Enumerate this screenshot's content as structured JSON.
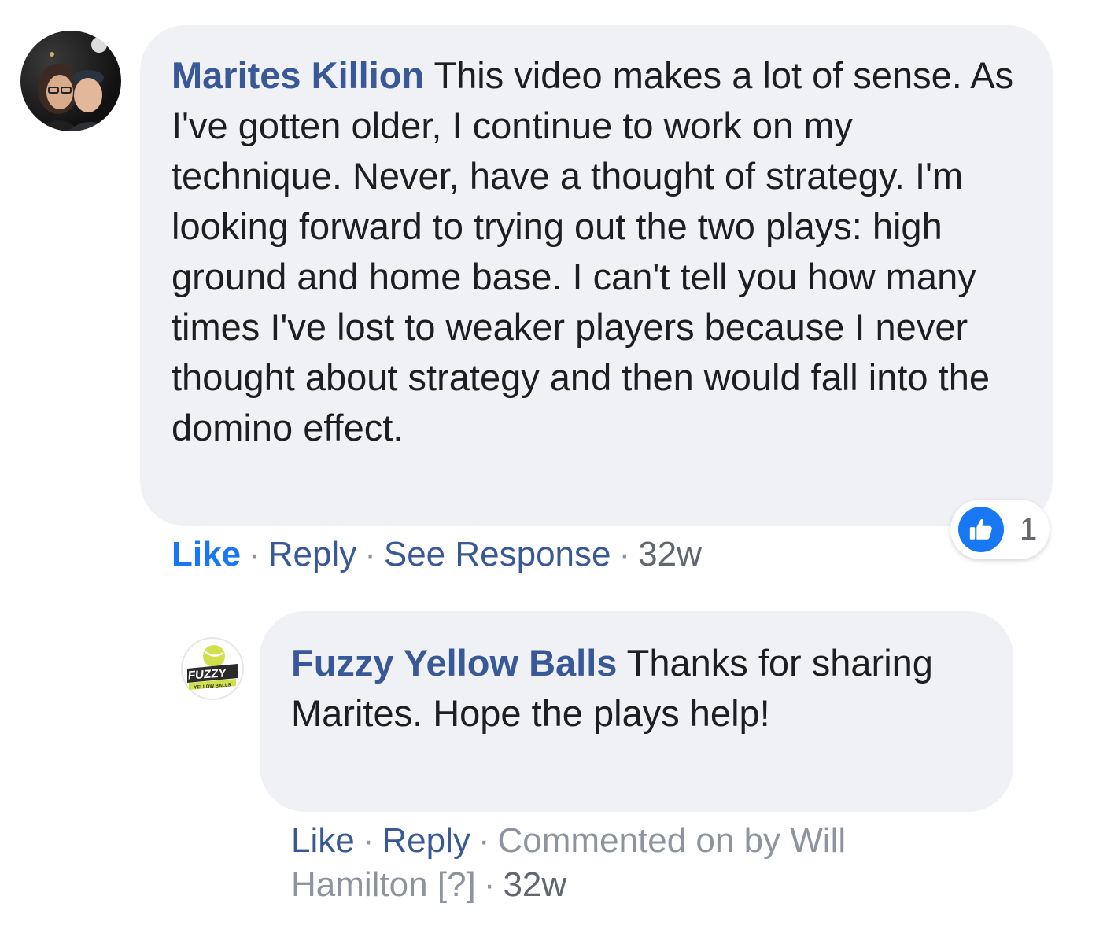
{
  "comment": {
    "author": "Marites Killion",
    "text": "This video makes a lot of sense. As I've gotten older, I continue to work on my technique. Never, have a thought of strategy. I'm looking forward to trying out the two plays: high ground and home base. I can't tell you how many times I've lost to weaker players because I never thought about strategy and then would fall into the domino effect.",
    "actions": {
      "like": "Like",
      "reply": "Reply",
      "see_response": "See Response",
      "time": "32w"
    },
    "reaction": {
      "icon": "thumbs-up-icon",
      "count": "1",
      "color": "#1877f2"
    }
  },
  "reply": {
    "author": "Fuzzy Yellow Balls",
    "text": "Thanks for sharing Marites. Hope the plays help!",
    "avatar_text": "FUZZY",
    "avatar_subtext": "YELLOW BALLS",
    "actions": {
      "like": "Like",
      "reply": "Reply",
      "commented_by": "Commented on by Will Hamilton",
      "help": "[?]",
      "time": "32w"
    }
  },
  "colors": {
    "name_blue": "#385898",
    "like_blue": "#1877f2",
    "bubble_bg": "#f0f1f4",
    "meta_grey": "#8d949e"
  }
}
